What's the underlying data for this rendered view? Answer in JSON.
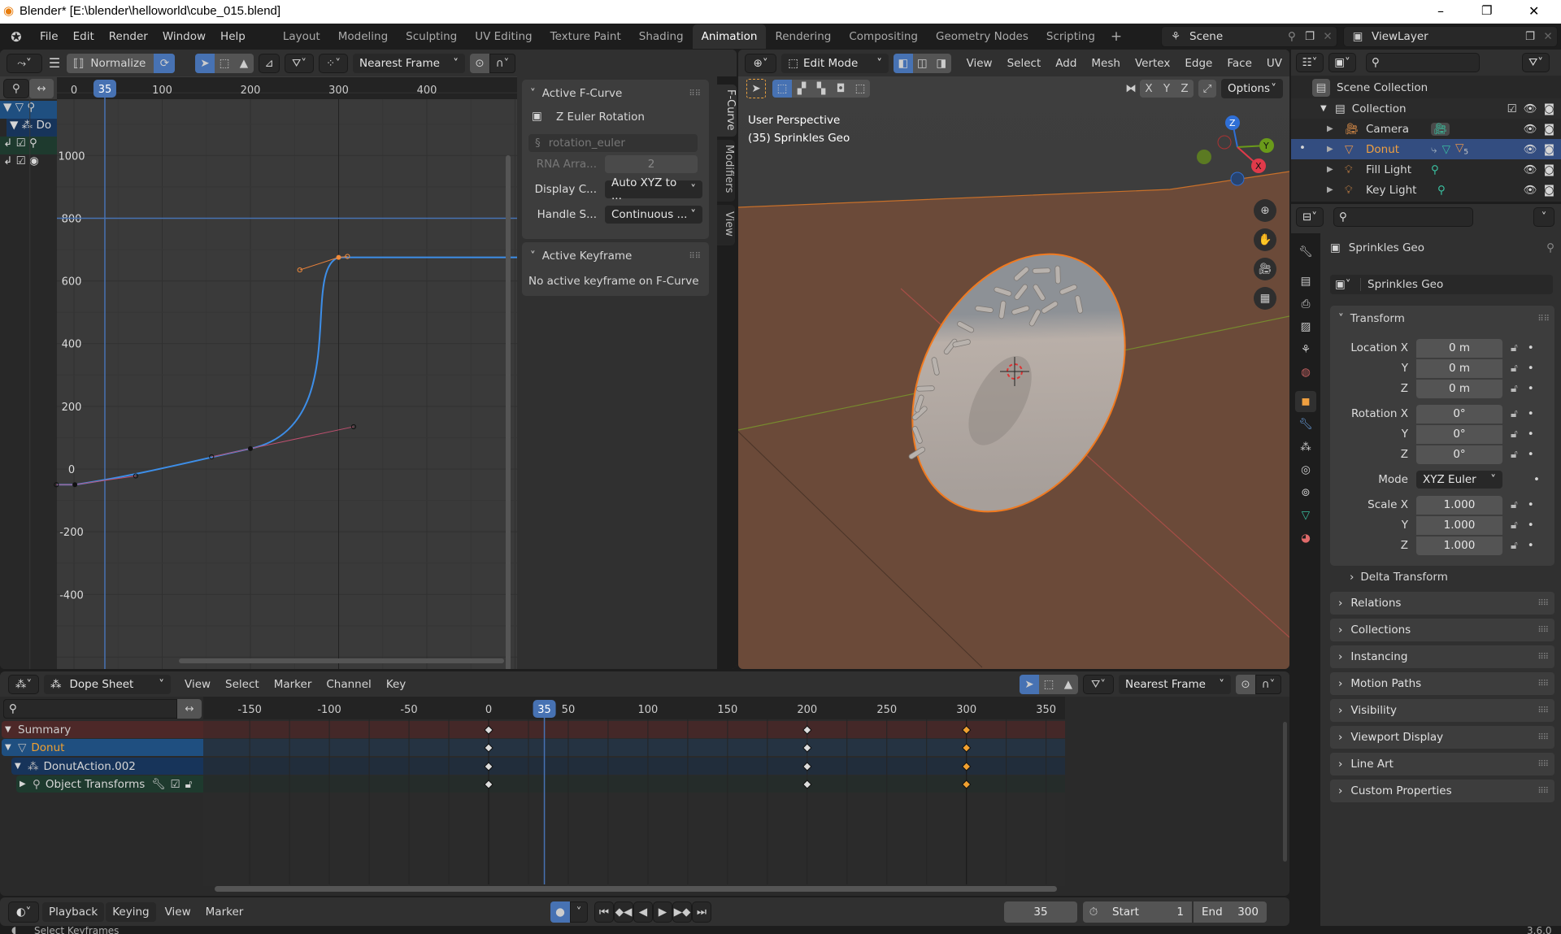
{
  "title_bar": {
    "title": "Blender* [E:\\blender\\helloworld\\cube_015.blend]",
    "minimize": "–",
    "maximize": "❐",
    "close": "✕"
  },
  "top_bar": {
    "menus": [
      "File",
      "Edit",
      "Render",
      "Window",
      "Help"
    ],
    "workspaces": [
      "Layout",
      "Modeling",
      "Sculpting",
      "UV Editing",
      "Texture Paint",
      "Shading",
      "Animation",
      "Rendering",
      "Compositing",
      "Geometry Nodes",
      "Scripting"
    ],
    "active_workspace": "Animation",
    "add_workspace": "+",
    "scene": "Scene",
    "view_layer": "ViewLayer"
  },
  "graph_editor": {
    "normalize_label": "Normalize",
    "snap": "Nearest Frame",
    "current_frame": "35",
    "x_ticks": [
      0,
      100,
      200,
      300,
      400
    ],
    "y_ticks": [
      1000,
      800,
      600,
      400,
      200,
      0,
      -200,
      -400
    ],
    "cursor_value": 800,
    "end_frame_line": 300,
    "channel_abbrev": "Do",
    "keyframes": [
      {
        "frame": 1,
        "value": -50,
        "handle_left": [
          -20,
          -50
        ],
        "handle_right": [
          70,
          -22
        ]
      },
      {
        "frame": 200,
        "value": 65,
        "handle_left": [
          156,
          39
        ],
        "handle_right": [
          317,
          135
        ]
      },
      {
        "frame": 300,
        "value": 675,
        "handle_left": [
          256,
          635
        ],
        "handle_right": [
          310,
          678
        ]
      }
    ],
    "sidebar": {
      "active_fcurve": {
        "title": "Active F-Curve",
        "name": "Z Euler Rotation",
        "path": "rotation_euler",
        "rna_label": "RNA Arra...",
        "rna_value": "2",
        "display_label": "Display C...",
        "display_value": "Auto XYZ to ...",
        "handle_label": "Handle S...",
        "handle_value": "Continuous ..."
      },
      "active_keyframe": {
        "title": "Active Keyframe",
        "message": "No active keyframe on F-Curve"
      },
      "tabs": [
        "F-Curve",
        "Modifiers",
        "View"
      ]
    }
  },
  "viewport": {
    "mode": "Edit Mode",
    "menus": [
      "View",
      "Select",
      "Add",
      "Mesh",
      "Vertex",
      "Edge",
      "Face",
      "UV"
    ],
    "axes": [
      "X",
      "Y",
      "Z"
    ],
    "options": "Options",
    "perspective": "User Perspective",
    "object_info": "(35) Sprinkles Geo",
    "gizmo": {
      "x": "X",
      "y": "Y",
      "z": "Z"
    },
    "colors": {
      "floor": "#6b4a39",
      "outline": "#f07a20",
      "x_axis": "#c0504d",
      "y_axis": "#7a9a2c"
    }
  },
  "outliner": {
    "scene_collection": "Scene Collection",
    "collection": "Collection",
    "items": [
      {
        "name": "Camera",
        "selected": false
      },
      {
        "name": "Donut",
        "selected": true,
        "modifier_count": "5"
      },
      {
        "name": "Fill Light",
        "selected": false
      },
      {
        "name": "Key Light",
        "selected": false
      }
    ]
  },
  "properties": {
    "object_name": "Sprinkles Geo",
    "data_name": "Sprinkles Geo",
    "transform_title": "Transform",
    "location": {
      "label": "Location X",
      "x": "0 m",
      "y": "0 m",
      "z": "0 m"
    },
    "rotation": {
      "label": "Rotation X",
      "x": "0°",
      "y": "0°",
      "z": "0°"
    },
    "mode_label": "Mode",
    "mode_value": "XYZ Euler",
    "scale": {
      "label": "Scale X",
      "x": "1.000",
      "y": "1.000",
      "z": "1.000"
    },
    "axis_labels": {
      "y": "Y",
      "z": "Z"
    },
    "delta_transform": "Delta Transform",
    "sections": [
      "Relations",
      "Collections",
      "Instancing",
      "Motion Paths",
      "Visibility",
      "Viewport Display",
      "Line Art",
      "Custom Properties"
    ]
  },
  "dope_sheet": {
    "mode": "Dope Sheet",
    "menus": [
      "View",
      "Select",
      "Marker",
      "Channel",
      "Key"
    ],
    "snap": "Nearest Frame",
    "current_frame": "35",
    "x_ticks": [
      -150,
      -100,
      -50,
      0,
      50,
      100,
      150,
      200,
      250,
      300,
      350
    ],
    "channels": [
      {
        "name": "Summary",
        "type": "summary"
      },
      {
        "name": "Donut",
        "type": "object"
      },
      {
        "name": "DonutAction.002",
        "type": "action"
      },
      {
        "name": "Object Transforms",
        "type": "group"
      }
    ],
    "keyframe_frames": [
      0,
      200,
      300
    ],
    "selected_frame": 300
  },
  "timeline": {
    "menus": [
      "Playback",
      "Keying",
      "View",
      "Marker"
    ],
    "current_frame": "35",
    "start_label": "Start",
    "start": "1",
    "end_label": "End",
    "end": "300"
  },
  "status_bar": {
    "hint": "Select Keyframes",
    "version": "3.6.0"
  }
}
